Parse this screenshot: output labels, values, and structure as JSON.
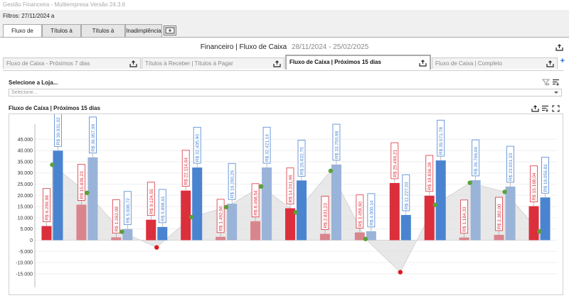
{
  "window": {
    "title": "Gestão Financeira - Multiempresa Versão 24.3.6"
  },
  "filters": {
    "text": "Filtros: 27/11/2024 a"
  },
  "top_tabs": [
    {
      "label": "Fluxo de Caixa",
      "active": true
    },
    {
      "label": "Títulos à Pagar",
      "active": false
    },
    {
      "label": "Títulos à Receber",
      "active": false
    },
    {
      "label": "Inadimplência",
      "active": false
    }
  ],
  "header": {
    "title": "Financeiro | Fluxo de Caixa",
    "period": "28/11/2024 - 25/02/2025"
  },
  "sub_tabs": [
    {
      "label": "Fluxo de Caixa - Próximos 7 dias",
      "active": false
    },
    {
      "label": "Títulos à Receber | Títulos à Pagar",
      "active": false
    },
    {
      "label": "Fluxo de Caixa | Próximos 15 dias",
      "active": true
    },
    {
      "label": "Fluxo de Caixa | Completo",
      "active": false
    }
  ],
  "add_tab": "+",
  "store_select": {
    "label": "Selecione a Loja...",
    "placeholder": "Selecione..."
  },
  "chart_panel": {
    "title": "Fluxo de Caixa | Próximos 15 dias"
  },
  "colors": {
    "red_bar": "#dc2f3c",
    "red_bar_light": "#d9858e",
    "blue_bar": "#4a84d0",
    "blue_bar_light": "#9ab3d8",
    "green_marker": "#5aa23a",
    "red_marker": "#e0191f",
    "area_fill": "#e0e0e0"
  },
  "chart_data": {
    "type": "bar",
    "title": "",
    "xlabel": "",
    "ylabel": "",
    "ylim": [
      -20000,
      45000
    ],
    "y_ticks": [
      "45.000",
      "40.000",
      "35.000",
      "30.000",
      "25.000",
      "20.000",
      "15.000",
      "10.000",
      "5.000",
      "0",
      "-5.000",
      "-10.000",
      "-15.000"
    ],
    "groups": [
      {
        "red": 6299.98,
        "red_label": "R$ 6.299,98",
        "blue": 39931.02,
        "blue_label": "R$ 39.931,02",
        "balance": 33631.04,
        "dim": false
      },
      {
        "red": 15839.23,
        "red_label": "R$ 15.839,23",
        "blue": 36957.99,
        "blue_label": "R$ 36.957,99",
        "balance": 21118.76,
        "dim": true
      },
      {
        "red": 1262.08,
        "red_label": "R$ 1.262,08",
        "blue": 5008.72,
        "blue_label": "R$ 5.008,72",
        "balance": 3746.64,
        "dim": true
      },
      {
        "red": 9124.55,
        "red_label": "R$ 9.124,55",
        "blue": 5898.61,
        "blue_label": "R$ 5.898,61",
        "balance": -3225.94,
        "dim": false
      },
      {
        "red": 22114.64,
        "red_label": "R$ 22.114,64",
        "blue": 32405.9,
        "blue_label": "R$ 32.405,90",
        "balance": 10291.26,
        "dim": false
      },
      {
        "red": 1492.66,
        "red_label": "R$ 1.492,66",
        "blue": 16260.26,
        "blue_label": "R$ 16.260,26",
        "balance": 14767.6,
        "dim": true
      },
      {
        "red": 8468.54,
        "red_label": "R$ 8.468,54",
        "blue": 32421.14,
        "blue_label": "R$ 32.421,14",
        "balance": 23952.6,
        "dim": true
      },
      {
        "red": 14241.96,
        "red_label": "R$ 14.241,96",
        "blue": 26632.75,
        "blue_label": "R$ 26.632,75",
        "balance": 12390.79,
        "dim": false
      },
      {
        "red": 2831.23,
        "red_label": "R$ 2.831,23",
        "blue": 33750.98,
        "blue_label": "R$ 33.750,98",
        "balance": 30919.75,
        "dim": true
      },
      {
        "red": 3459.6,
        "red_label": "R$ 3.459,60",
        "blue": 4000.14,
        "blue_label": "R$ 4.000,14",
        "balance": 540.54,
        "dim": true
      },
      {
        "red": 25499.21,
        "red_label": "R$ 25.499,21",
        "blue": 11227.03,
        "blue_label": "R$ 11.227,03",
        "balance": -14272.18,
        "dim": false
      },
      {
        "red": 19836.28,
        "red_label": "R$ 19.836,28",
        "blue": 35571.78,
        "blue_label": "R$ 35.571,78",
        "balance": 15735.5,
        "dim": false
      },
      {
        "red": 1184.33,
        "red_label": "R$ 1.184,33",
        "blue": 26766.04,
        "blue_label": "R$ 26.766,04",
        "balance": 25581.71,
        "dim": true
      },
      {
        "red": 2382.0,
        "red_label": "R$ 2.382,00",
        "blue": 23931.33,
        "blue_label": "R$ 23.931,33",
        "balance": 21549.33,
        "dim": true
      },
      {
        "red": 15168.04,
        "red_label": "R$ 15.168,04",
        "blue": 19056.81,
        "blue_label": "R$ 19.056,81",
        "balance": 3888.77,
        "dim": false
      }
    ]
  }
}
